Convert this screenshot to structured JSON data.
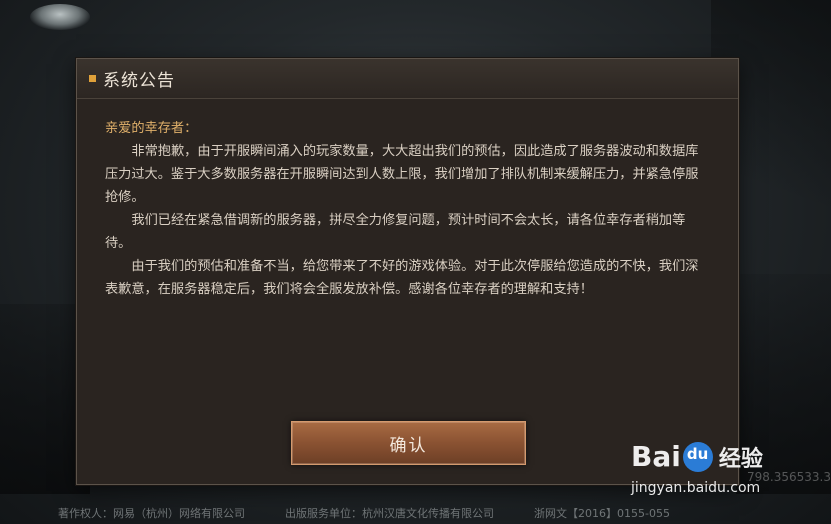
{
  "dialog": {
    "title": "系统公告",
    "greeting": "亲爱的幸存者：",
    "paragraphs": [
      "非常抱歉，由于开服瞬间涌入的玩家数量，大大超出我们的预估，因此造成了服务器波动和数据库压力过大。鉴于大多数服务器在开服瞬间达到人数上限，我们增加了排队机制来缓解压力，并紧急停服抢修。",
      "我们已经在紧急借调新的服务器，拼尽全力修复问题，预计时间不会太长，请各位幸存者稍加等待。",
      "由于我们的预估和准备不当，给您带来了不好的游戏体验。对于此次停服给您造成的不快，我们深表歉意，在服务器稳定后，我们将会全服发放补偿。感谢各位幸存者的理解和支持！"
    ],
    "confirm_label": "确认"
  },
  "footer": {
    "copyright": "著作权人：网易（杭州）网络有限公司",
    "publisher": "出版服务单位：杭州汉唐文化传播有限公司",
    "license": "浙网文【2016】0155-055"
  },
  "side_text": "798.356533.3",
  "watermark": {
    "brand_left": "Bai",
    "brand_jingyan": "经验",
    "url": "jingyan.baidu.com"
  }
}
